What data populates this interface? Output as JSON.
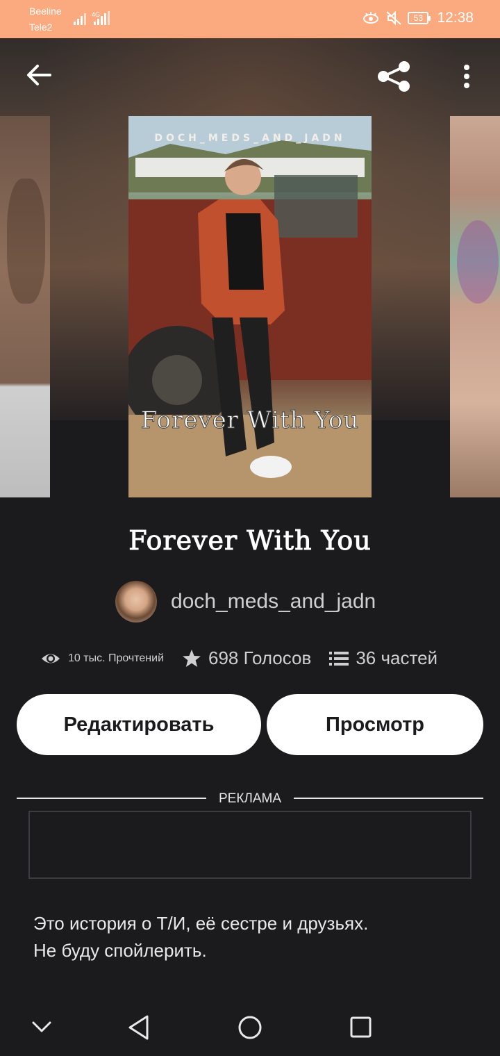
{
  "status_bar": {
    "carrier1": "Beeline",
    "carrier2": "Tele2",
    "network": "4G",
    "battery": "53",
    "time": "12:38",
    "icons": [
      "signal-icon",
      "eye-comfort-icon",
      "mute-icon",
      "battery-icon"
    ]
  },
  "toolbar": {
    "back_icon": "arrow-left-icon",
    "share_icon": "share-icon",
    "more_icon": "more-vertical-icon"
  },
  "cover": {
    "author_text": "DOCH_MEDS_AND_JADN",
    "title_text": "Forever With You"
  },
  "story": {
    "title": "Forever With You",
    "author": "doch_meds_and_jadn",
    "reads": "10 тыс. Прочтений",
    "votes": "698 Голосов",
    "parts": "36 частей",
    "description_line1": "Это история о Т/И, её сестре и друзьях.",
    "description_line2": "Не буду спойлерить."
  },
  "actions": {
    "edit_label": "Редактировать",
    "view_label": "Просмотр"
  },
  "ad": {
    "label": "РЕКЛАМА"
  },
  "colors": {
    "status_bar": "#fbaa7f",
    "background": "#1b1a1d",
    "button_bg": "#ffffff",
    "muted_text": "#cfcfcf"
  },
  "navbar": {
    "icons": [
      "chevron-down-icon",
      "back-triangle-icon",
      "home-circle-icon",
      "recents-square-icon"
    ]
  }
}
